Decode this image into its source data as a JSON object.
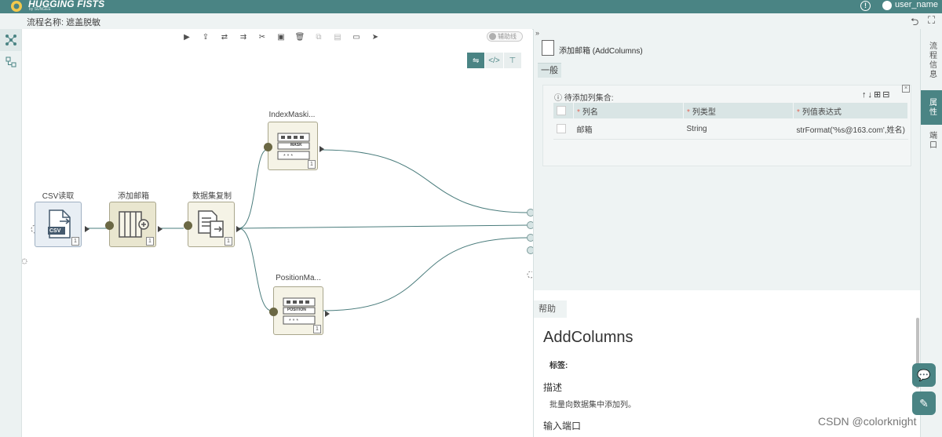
{
  "app": {
    "brand": "HUGGING FISTS",
    "brand_sub": "by SUNGEE",
    "user": "user_name",
    "flow_title": "流程名称: 遮盖脱敏"
  },
  "toolbar": {
    "assist_label": "辅助线"
  },
  "canvas": {
    "nodes": [
      {
        "id": "csv",
        "label": "CSV读取",
        "icon_text": "CSV",
        "count": "1"
      },
      {
        "id": "add",
        "label": "添加邮箱",
        "count": "1"
      },
      {
        "id": "copy",
        "label": "数据集复制",
        "count": "1"
      },
      {
        "id": "index",
        "label": "IndexMaski...",
        "icon_text": "MASK",
        "count": "1"
      },
      {
        "id": "position",
        "label": "PositionMa...",
        "icon_text": "POSITION",
        "count": "1"
      }
    ]
  },
  "panel": {
    "header": "添加邮箱 (AddColumns)",
    "tab_general": "一般",
    "section_label": "待添加列集合:",
    "actions": "↑↓⊞⊟",
    "columns": [
      "列名",
      "列类型",
      "列值表达式"
    ],
    "rows": [
      {
        "name": "邮箱",
        "type": "String",
        "expr": "strFormat('%s@163.com',姓名)"
      }
    ],
    "help_tab": "帮助",
    "help_title": "AddColumns",
    "help_tags": "标签:",
    "help_desc_heading": "描述",
    "help_desc": "批量向数据集中添加列。",
    "help_input_heading": "输入端口"
  },
  "rightrail": {
    "items": [
      "流程信息",
      "属性",
      "端口"
    ]
  },
  "watermark": "CSDN @colorknight",
  "colors": {
    "accent": "#4a8484",
    "node_fill": "#f5f3e6",
    "edge": "#4a7c7c"
  }
}
